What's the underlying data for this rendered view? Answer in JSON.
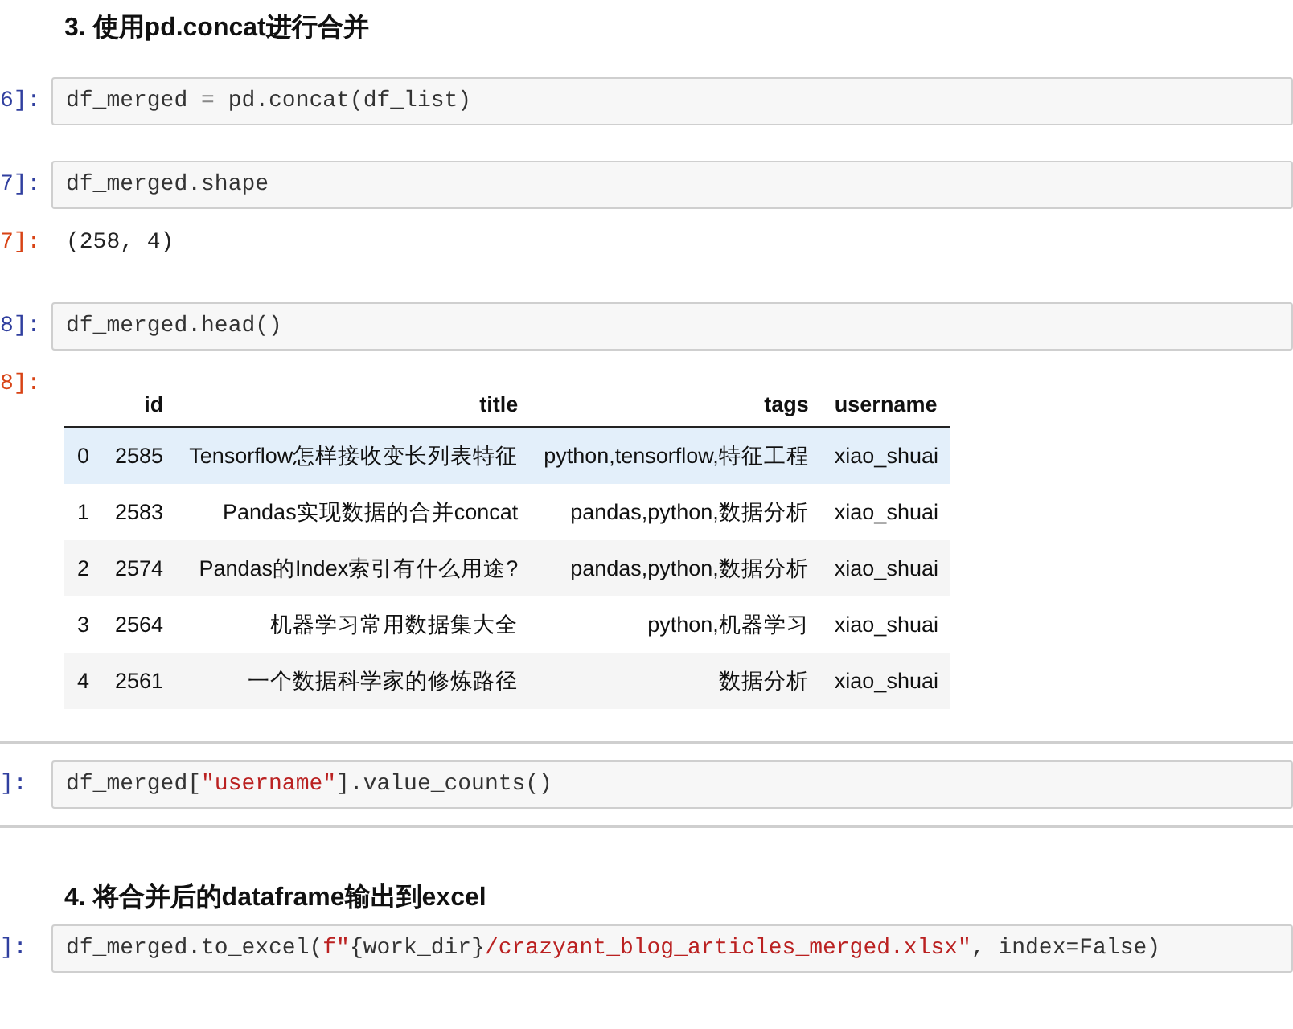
{
  "cells": [
    {
      "kind": "markdown",
      "text": "3. 使用pd.concat进行合并"
    },
    {
      "kind": "code",
      "prompt": "6]:",
      "code": [
        {
          "kind": "plain",
          "text": "df_merged "
        },
        {
          "kind": "op",
          "text": "="
        },
        {
          "kind": "plain",
          "text": " pd.concat(df_list)"
        }
      ]
    },
    {
      "kind": "code",
      "prompt": "7]:",
      "code": [
        {
          "kind": "plain",
          "text": "df_merged.shape"
        }
      ],
      "output_prompt": "7]:",
      "output": "(258, 4)"
    },
    {
      "kind": "code",
      "prompt": "8]:",
      "code": [
        {
          "kind": "plain",
          "text": "df_merged.head()"
        }
      ],
      "output_prompt": "8]:",
      "table": {
        "columns": [
          "",
          "id",
          "title",
          "tags",
          "username"
        ],
        "rows": [
          {
            "highlighted": true,
            "cells": [
              "0",
              "2585",
              "Tensorflow怎样接收变长列表特征",
              "python,tensorflow,特征工程",
              "xiao_shuai"
            ]
          },
          {
            "highlighted": false,
            "cells": [
              "1",
              "2583",
              "Pandas实现数据的合并concat",
              "pandas,python,数据分析",
              "xiao_shuai"
            ]
          },
          {
            "highlighted": false,
            "cells": [
              "2",
              "2574",
              "Pandas的Index索引有什么用途?",
              "pandas,python,数据分析",
              "xiao_shuai"
            ]
          },
          {
            "highlighted": false,
            "cells": [
              "3",
              "2564",
              "机器学习常用数据集大全",
              "python,机器学习",
              "xiao_shuai"
            ]
          },
          {
            "highlighted": false,
            "cells": [
              "4",
              "2561",
              "一个数据科学家的修炼路径",
              "数据分析",
              "xiao_shuai"
            ]
          }
        ]
      }
    },
    {
      "kind": "code",
      "prompt": "]:",
      "framed": true,
      "code": [
        {
          "kind": "plain",
          "text": "df_merged["
        },
        {
          "kind": "string",
          "text": "\"username\""
        },
        {
          "kind": "plain",
          "text": "].value_counts()"
        }
      ]
    },
    {
      "kind": "markdown",
      "text": "4. 将合并后的dataframe输出到excel"
    },
    {
      "kind": "code",
      "prompt": "]:",
      "code": [
        {
          "kind": "plain",
          "text": "df_merged.to_excel("
        },
        {
          "kind": "string",
          "text": "f\""
        },
        {
          "kind": "plain",
          "text": "{work_dir}"
        },
        {
          "kind": "string",
          "text": "/crazyant_blog_articles_merged.xlsx\""
        },
        {
          "kind": "plain",
          "text": ", index=False)"
        }
      ]
    }
  ]
}
